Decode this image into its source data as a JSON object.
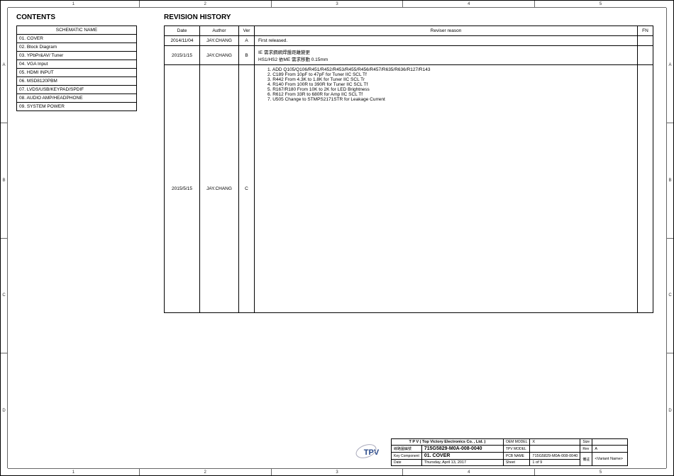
{
  "ruler": {
    "cols": [
      "1",
      "2",
      "3",
      "4",
      "5"
    ],
    "rows": [
      "A",
      "B",
      "C",
      "D"
    ]
  },
  "headings": {
    "contents": "CONTENTS",
    "history": "REVISION HISTORY"
  },
  "contents": {
    "header": "SCHEMATIC NAME",
    "items": [
      "01. COVER",
      "02. Block Diagram",
      "03. YPbPr&AV/ Tuner",
      "04. VGA Input",
      "05. HDMI INPUT",
      "06. MSD8120PBM",
      "07. LVDS/USB/KEYPAD/SPDIF",
      "08. AUDIO AMP/HEADPHONE",
      "09. SYSTEM POWER"
    ]
  },
  "rev": {
    "cols": {
      "date": "Date",
      "author": "Author",
      "ver": "Ver",
      "reason": "Reviser reason",
      "fn": "FN"
    },
    "rows": [
      {
        "date": "2014/11/04",
        "author": "JAY.CHANG",
        "ver": "A",
        "reason": "First released.",
        "fn": ""
      },
      {
        "date": "2015/1/15",
        "author": "JAY.CHANG",
        "ver": "B",
        "reason": "IE 需求鋼網焊盤距離變更\nHS1/HS2 依ME 需求移動 0.15mm",
        "fn": ""
      },
      {
        "date": "2015/5/15",
        "author": "JAY.CHANG",
        "ver": "C",
        "reason": "1. ADD Q105/Q106/R451/R452/R453/R455/R456/R457/R635/R636/R127/R143\n2. C189 From 10pF to 47pF for Tuner IIC SCL Tf\n3. R442   From 4.3K to 1.8K for Tuner  IIC SCL Tr\n4. R140   From 100R to 390R for Tuner IIC SCL Tf\n5. R167/R180 From 10K to 2K for LED Brightness\n6. R612   From 33R to 680R for Amp IIC SCL Tf\n7. U505 Change to STMPS2171STR   for Leakage Current",
        "fn": ""
      }
    ]
  },
  "title": {
    "logo": "TPV",
    "company": "T P V   ( Top   Victory   Electronics   Co. ,  Ltd. )",
    "lbl_line": "線路圖編號",
    "partno": "715G5829-M0A-008-0040",
    "lbl_key": "Key Component",
    "pagename": "01. COVER",
    "lbl_date": "Date",
    "date": "Thursday, April 13, 2017",
    "lbl_oem": "OEM MODEL",
    "oem": "X",
    "lbl_tpvmodel": "TPV MODEL",
    "tpvmodel": "",
    "lbl_pcb": "PCB NAME",
    "pcb": "715G5829-M0A-008-0040",
    "lbl_sheet": "Sheet",
    "sheet": "1    of    9",
    "lbl_size": "Size",
    "size": "",
    "lbl_rev": "Rev",
    "rev": "A",
    "lbl_note": "備註",
    "note": "<Variant Name>"
  }
}
